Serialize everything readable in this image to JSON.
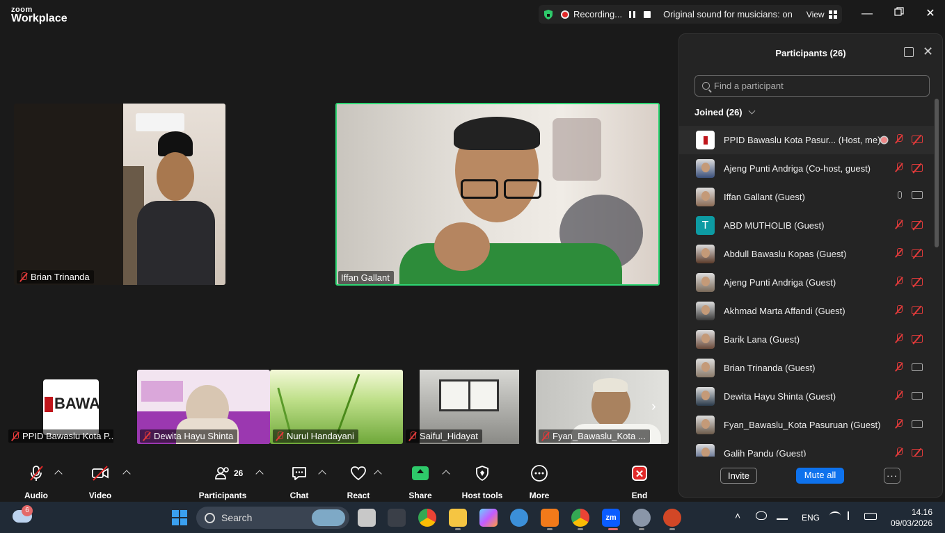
{
  "titlebar": {
    "logo_top": "zoom",
    "logo_bottom": "Workplace",
    "recording_label": "Recording...",
    "sound_label": "Original sound for musicians: on",
    "view_label": "View"
  },
  "videos": {
    "main_left_name": "Brian Trinanda",
    "main_right_name": "Iffan Gallant",
    "strip": [
      {
        "name": "PPID Bawaslu Kota P..."
      },
      {
        "name": "Dewita Hayu Shinta"
      },
      {
        "name": "Nurul Handayani"
      },
      {
        "name": "Saiful_Hidayat"
      },
      {
        "name": "Fyan_Bawaslu_Kota ..."
      }
    ],
    "logo_text": "BAWAS"
  },
  "panel": {
    "title": "Participants (26)",
    "search_placeholder": "Find a participant",
    "joined_label": "Joined (26)",
    "participants": [
      {
        "name": "PPID Bawaslu Kota Pasur...  (Host, me)",
        "avatar": "logo",
        "mic": "off",
        "video": "off"
      },
      {
        "name": "Ajeng Punti Andriga (Co-host, guest)",
        "avatar": "photo",
        "mic": "off",
        "video": "off"
      },
      {
        "name": "Iffan Gallant (Guest)",
        "avatar": "photo",
        "mic": "on",
        "video": "on"
      },
      {
        "name": "ABD MUTHOLIB (Guest)",
        "avatar": "T",
        "mic": "off",
        "video": "off"
      },
      {
        "name": "Abdull Bawaslu Kopas (Guest)",
        "avatar": "photo",
        "mic": "off",
        "video": "off"
      },
      {
        "name": "Ajeng Punti Andriga (Guest)",
        "avatar": "photo",
        "mic": "off",
        "video": "off"
      },
      {
        "name": "Akhmad Marta Affandi (Guest)",
        "avatar": "photo",
        "mic": "off",
        "video": "off"
      },
      {
        "name": "Barik Lana (Guest)",
        "avatar": "photo",
        "mic": "off",
        "video": "off"
      },
      {
        "name": "Brian Trinanda (Guest)",
        "avatar": "photo",
        "mic": "off",
        "video": "on"
      },
      {
        "name": "Dewita Hayu Shinta (Guest)",
        "avatar": "photo",
        "mic": "off",
        "video": "on"
      },
      {
        "name": "Fyan_Bawaslu_Kota Pasuruan (Guest)",
        "avatar": "photo",
        "mic": "off",
        "video": "on"
      },
      {
        "name": "Galih Pandu (Guest)",
        "avatar": "photo",
        "mic": "off",
        "video": "off"
      }
    ],
    "invite_label": "Invite",
    "mute_all_label": "Mute all",
    "more_label": "···"
  },
  "toolbar": {
    "audio": "Audio",
    "video": "Video",
    "participants": "Participants",
    "participants_count": "26",
    "chat": "Chat",
    "react": "React",
    "share": "Share",
    "host_tools": "Host tools",
    "more": "More",
    "end": "End"
  },
  "taskbar": {
    "weather_badge": "6",
    "search_label": "Search",
    "lang": "ENG",
    "time": "14.16",
    "date": "09/03/2026"
  }
}
